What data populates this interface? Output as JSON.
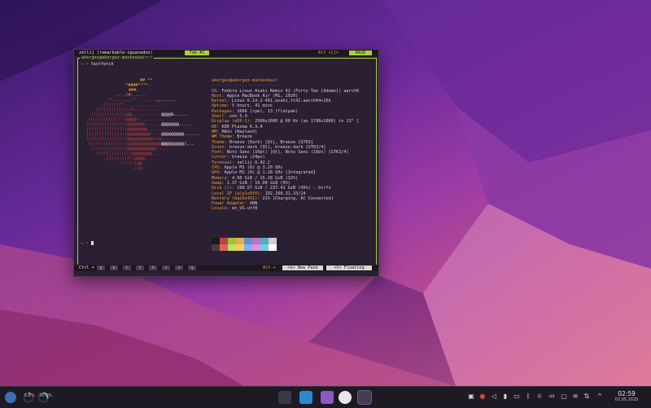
{
  "terminal": {
    "window_title": "zellij (remarkable-iguanadon)",
    "tab_label": "Tab #1",
    "mode_alt": "Alt <[]>",
    "mode_base": "BASE",
    "pane_title": "akergez@akergez-macbookair:~",
    "prompt_symbol": "→",
    "prompt_dir": "~",
    "command": "fastfetch",
    "second_prompt": "→ ~",
    "info": {
      "header": "akergez@akergez-macbookair",
      "separator": "---------------------------",
      "rows": [
        {
          "k": "OS:",
          "v": "Fedora Linux Asahi Remix 42 (Forty Two [Adams]) aarch6"
        },
        {
          "k": "Host:",
          "v": "Apple MacBook Air (M1, 2020)"
        },
        {
          "k": "Kernel:",
          "v": "Linux 6.14.2-401.asahi.fc42.aarch64+16k"
        },
        {
          "k": "Uptime:",
          "v": "5 hours, 41 mins"
        },
        {
          "k": "Packages:",
          "v": "2666 (rpm), 13 (flatpak)"
        },
        {
          "k": "Shell:",
          "v": "zsh 5.9"
        },
        {
          "k": "Display (eDP-1):",
          "v": "2560x1600 @ 60 Hz (as 1706x1066) in 13\" ["
        },
        {
          "k": "DE:",
          "v": "KDE Plasma 6.3.4"
        },
        {
          "k": "WM:",
          "v": "KWin (Wayland)"
        },
        {
          "k": "WM Theme:",
          "v": "Breeze"
        },
        {
          "k": "Theme:",
          "v": "Breeze (Dark) [Qt], Breeze [GTK3]"
        },
        {
          "k": "Icons:",
          "v": "breeze-dark [Qt], breeze-dark [GTK3/4]"
        },
        {
          "k": "Font:",
          "v": "Noto Sans (10pt) [Qt], Noto Sans (10pt) [GTK3/4]"
        },
        {
          "k": "Cursor:",
          "v": "breeze (24px)"
        },
        {
          "k": "Terminal:",
          "v": "zellij 0.42.2"
        },
        {
          "k": "CPU:",
          "v": "Apple M1 (8) @ 3.20 GHz"
        },
        {
          "k": "GPU:",
          "v": "Apple M1 (8) @ 1.28 GHz [Integrated]"
        },
        {
          "k": "Memory:",
          "v": "4.90 GiB / 15.28 GiB (32%)"
        },
        {
          "k": "Swap:",
          "v": "1.37 GiB / 16.00 GiB (9%)"
        },
        {
          "k": "Disk (/):",
          "v": "190.57 GiB / 237.41 GiB (56%) - btrfs"
        },
        {
          "k": "Local IP (wlp1s0f0):",
          "v": "192.168.31.33/24"
        },
        {
          "k": "Battery (bq20z451):",
          "v": "21% [Charging, AC Connected]"
        },
        {
          "k": "Power Adapter:",
          "v": "40W"
        },
        {
          "k": "Locale:",
          "v": "en_US.utf8"
        }
      ]
    },
    "status": {
      "ctrl_label": "Ctrl +",
      "keys": [
        "g",
        "p",
        "t",
        "n",
        "h",
        "s",
        "o",
        "q"
      ],
      "alt_label": "Alt +",
      "new_pane": "<n> New Pane",
      "floating": "<f> Floating"
    },
    "swatch_colors": [
      "#1a1a1a",
      "#c04040",
      "#a0c040",
      "#e0b040",
      "#6090d0",
      "#c070c0",
      "#50b0c0",
      "#d0d0d0",
      "#404040",
      "#e06060",
      "#c0e060",
      "#f0d060",
      "#80b0f0",
      "#e090e0",
      "#70d0e0",
      "#ffffff"
    ]
  },
  "taskbar": {
    "cpu_label": "5.8%",
    "mem_label": "35.6%",
    "clock_time": "02:59",
    "clock_date": "02.05.2025",
    "keyboard_layout": "us"
  }
}
